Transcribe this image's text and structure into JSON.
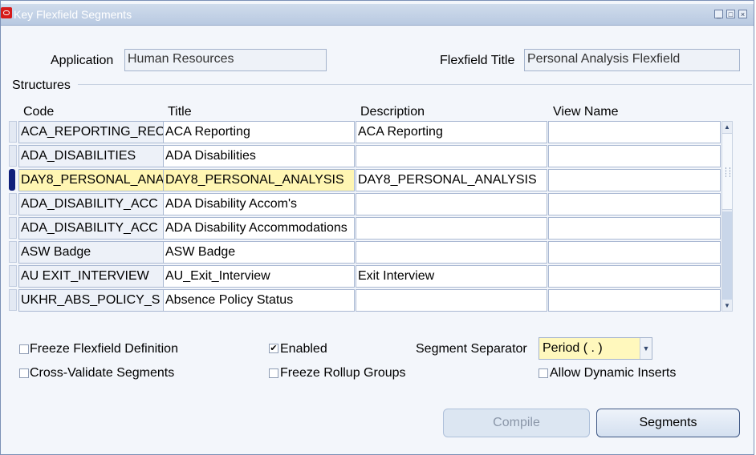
{
  "window": {
    "title": "Key Flexfield Segments"
  },
  "header": {
    "application_label": "Application",
    "application_value": "Human Resources",
    "flexfield_title_label": "Flexfield Title",
    "flexfield_title_value": "Personal Analysis Flexfield"
  },
  "structures": {
    "section_label": "Structures",
    "columns": {
      "code": "Code",
      "title": "Title",
      "description": "Description",
      "view_name": "View Name"
    },
    "rows": [
      {
        "code": "ACA_REPORTING_REC",
        "title": "ACA Reporting",
        "description": "ACA Reporting",
        "view_name": ""
      },
      {
        "code": "ADA_DISABILITIES",
        "title": "ADA Disabilities",
        "description": "",
        "view_name": ""
      },
      {
        "code": "DAY8_PERSONAL_ANA",
        "title": "DAY8_PERSONAL_ANALYSIS",
        "description": "DAY8_PERSONAL_ANALYSIS",
        "view_name": ""
      },
      {
        "code": "ADA_DISABILITY_ACC",
        "title": "ADA Disability Accom's",
        "description": "",
        "view_name": ""
      },
      {
        "code": "ADA_DISABILITY_ACC",
        "title": "ADA Disability Accommodations",
        "description": "",
        "view_name": ""
      },
      {
        "code": "ASW Badge",
        "title": "ASW Badge",
        "description": "",
        "view_name": ""
      },
      {
        "code": "AU EXIT_INTERVIEW",
        "title": "AU_Exit_Interview",
        "description": "Exit Interview",
        "view_name": ""
      },
      {
        "code": "UKHR_ABS_POLICY_S",
        "title": "Absence Policy Status",
        "description": "",
        "view_name": ""
      }
    ],
    "selected_row": 2
  },
  "options": {
    "freeze_definition": {
      "label": "Freeze Flexfield Definition",
      "checked": false
    },
    "cross_validate": {
      "label": "Cross-Validate Segments",
      "checked": false
    },
    "enabled": {
      "label": "Enabled",
      "checked": true
    },
    "freeze_rollup": {
      "label": "Freeze Rollup Groups",
      "checked": false
    },
    "allow_dynamic": {
      "label": "Allow Dynamic Inserts",
      "checked": false
    },
    "segment_separator_label": "Segment Separator",
    "segment_separator_value": "Period ( . )"
  },
  "buttons": {
    "compile": "Compile",
    "segments": "Segments"
  },
  "icons": {
    "check": "✔",
    "arrow_up": "▲",
    "arrow_down": "▼"
  },
  "colors": {
    "highlight": "#fff6b3",
    "selected_indicator": "#10207a",
    "marker": "#e4f216"
  }
}
